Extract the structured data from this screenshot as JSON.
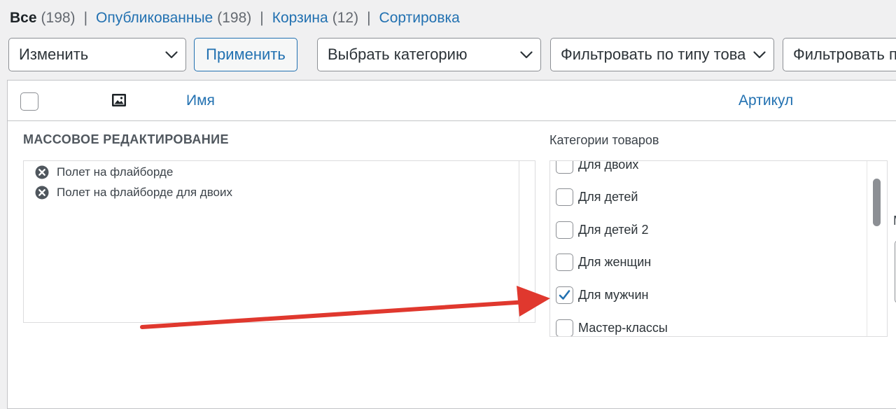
{
  "views": [
    {
      "label": "Все",
      "count": "(198)",
      "current": true
    },
    {
      "label": "Опубликованные",
      "count": "(198)",
      "current": false
    },
    {
      "label": "Корзина",
      "count": "(12)",
      "current": false
    },
    {
      "label": "Сортировка",
      "count": "",
      "current": false
    }
  ],
  "tablenav": {
    "bulk_action_value": "Изменить",
    "apply_label": "Применить",
    "category_filter_value": "Выбрать категорию",
    "type_filter_value": "Фильтровать по типу товара",
    "stock_filter_value": "Фильтровать по наличию"
  },
  "columns": {
    "name": "Имя",
    "sku": "Артикул"
  },
  "bulk_edit": {
    "title": "МАССОВОЕ РЕДАКТИРОВАНИЕ",
    "items": [
      "Полет на флайборде",
      "Полет на флайборде для двоих"
    ]
  },
  "categories": {
    "heading": "Категории товаров",
    "items": [
      {
        "label": "Для двоих",
        "checked": false
      },
      {
        "label": "Для детей",
        "checked": false
      },
      {
        "label": "Для детей 2",
        "checked": false
      },
      {
        "label": "Для женщин",
        "checked": false
      },
      {
        "label": "Для мужчин",
        "checked": true
      },
      {
        "label": "Мастер-классы",
        "checked": false
      }
    ]
  },
  "right_column_partial_label": "M",
  "colors": {
    "link": "#2271b1",
    "arrow": "#e0382e",
    "checkmark": "#2271b1"
  }
}
